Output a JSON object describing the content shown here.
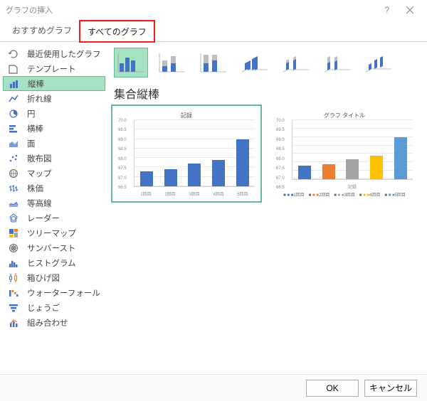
{
  "dialog": {
    "title": "グラフの挿入"
  },
  "tabs": [
    {
      "label": "おすすめグラフ",
      "active": false
    },
    {
      "label": "すべてのグラフ",
      "active": true,
      "highlight": true
    }
  ],
  "sidebar": {
    "items": [
      {
        "label": "最近使用したグラフ",
        "icon": "recent-icon"
      },
      {
        "label": "テンプレート",
        "icon": "template-icon"
      },
      {
        "label": "縦棒",
        "icon": "column-icon",
        "selected": true
      },
      {
        "label": "折れ線",
        "icon": "line-icon"
      },
      {
        "label": "円",
        "icon": "pie-icon"
      },
      {
        "label": "横棒",
        "icon": "bar-icon"
      },
      {
        "label": "面",
        "icon": "area-icon"
      },
      {
        "label": "散布図",
        "icon": "scatter-icon"
      },
      {
        "label": "マップ",
        "icon": "map-icon"
      },
      {
        "label": "株価",
        "icon": "stock-icon"
      },
      {
        "label": "等高線",
        "icon": "surface-icon"
      },
      {
        "label": "レーダー",
        "icon": "radar-icon"
      },
      {
        "label": "ツリーマップ",
        "icon": "treemap-icon"
      },
      {
        "label": "サンバースト",
        "icon": "sunburst-icon"
      },
      {
        "label": "ヒストグラム",
        "icon": "histogram-icon"
      },
      {
        "label": "箱ひげ図",
        "icon": "boxwhisker-icon"
      },
      {
        "label": "ウォーターフォール",
        "icon": "waterfall-icon"
      },
      {
        "label": "じょうご",
        "icon": "funnel-icon"
      },
      {
        "label": "組み合わせ",
        "icon": "combo-icon"
      }
    ]
  },
  "subtypes": [
    {
      "id": "clustered-column",
      "selected": true
    },
    {
      "id": "stacked-column"
    },
    {
      "id": "stacked-100-column"
    },
    {
      "id": "3d-clustered-column"
    },
    {
      "id": "3d-stacked-column"
    },
    {
      "id": "3d-stacked-100-column"
    },
    {
      "id": "3d-column"
    }
  ],
  "subtitle": "集合縦棒",
  "previews": [
    {
      "title": "記録",
      "selected": true
    },
    {
      "title": "グラフ タイトル",
      "legend_label": "記録"
    }
  ],
  "chart_data": [
    {
      "type": "bar",
      "title": "記録",
      "categories": [
        "1回目",
        "2回目",
        "3回目",
        "4回目",
        "5回目"
      ],
      "values": [
        67.3,
        67.4,
        67.7,
        67.9,
        69.0
      ],
      "ylim": [
        66.5,
        70.0
      ],
      "ylabel": "",
      "xlabel": ""
    },
    {
      "type": "bar",
      "title": "グラフ タイトル",
      "categories": [
        "1回目",
        "2回目",
        "3回目",
        "4回目",
        "5回目"
      ],
      "series": [
        {
          "name": "記録",
          "values": [
            67.3,
            67.4,
            67.7,
            67.9,
            69.0
          ],
          "colors": [
            "#4472c4",
            "#ed7d31",
            "#a5a5a5",
            "#ffc000",
            "#5b9bd5"
          ]
        }
      ],
      "yticks": [
        66.5,
        67.0,
        67.5,
        68.0,
        68.5,
        69.0,
        69.5,
        70.0
      ],
      "ylim": [
        66.5,
        70.0
      ],
      "legend": [
        "1回目",
        "2回目",
        "3回目",
        "4回目",
        "5回目"
      ]
    }
  ],
  "footer": {
    "ok": "OK",
    "cancel": "キャンセル"
  }
}
